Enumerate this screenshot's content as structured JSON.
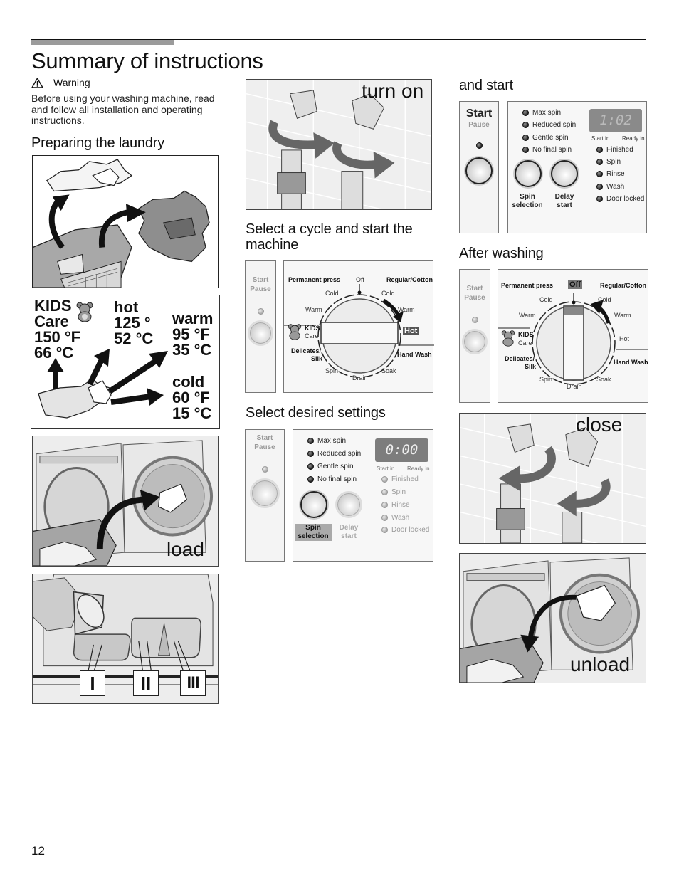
{
  "page": {
    "title": "Summary of instructions",
    "page_number": "12"
  },
  "warning": {
    "icon": "warning-triangle-icon",
    "label": "Warning",
    "text": "Before using your washing machine, read and follow all installation and operating instructions."
  },
  "sections": {
    "preparing": "Preparing the laundry",
    "select_cycle": "Select a cycle and start the machine",
    "select_settings": "Select desired settings",
    "and_start": "and start",
    "after_washing": "After washing"
  },
  "illustrations": {
    "turn_on": "turn on",
    "load": "load",
    "close": "close",
    "unload": "unload",
    "dispenser_compartments": [
      "I",
      "II",
      "III"
    ]
  },
  "temperatures": [
    {
      "name": "KIDS",
      "name2": "Care",
      "f": "150 °F",
      "c": "66 °C",
      "icon": "teddy-bear-icon"
    },
    {
      "name": "hot",
      "f": "125 °",
      "c": "52 °C"
    },
    {
      "name": "warm",
      "f": "95 °F",
      "c": "35 °C"
    },
    {
      "name": "cold",
      "f": "60 °F",
      "c": "15 °C"
    }
  ],
  "dial": {
    "top": "Off",
    "permanent_press": "Permanent press",
    "regular_cotton": "Regular/Cotton",
    "pp_cold": "Cold",
    "pp_warm": "Warm",
    "rc_cold": "Cold",
    "rc_warm": "Warm",
    "rc_hot": "Hot",
    "kids": "KIDS",
    "care": "Care",
    "delicates": "Delicates/",
    "silk": "Silk",
    "hand_wash": "Hand Wash",
    "spin": "Spin",
    "drain": "Drain",
    "soak": "Soak"
  },
  "control_panel": {
    "start": "Start",
    "pause": "Pause",
    "spin_options": [
      "Max spin",
      "Reduced spin",
      "Gentle spin",
      "No final spin"
    ],
    "status_leds": [
      "Finished",
      "Spin",
      "Rinse",
      "Wash",
      "Door locked"
    ],
    "start_in": "Start in",
    "ready_in": "Ready in",
    "spin_selection": [
      "Spin",
      "selection"
    ],
    "delay_start": [
      "Delay",
      "start"
    ],
    "display_settings": "0:00",
    "display_start": "1:02"
  }
}
